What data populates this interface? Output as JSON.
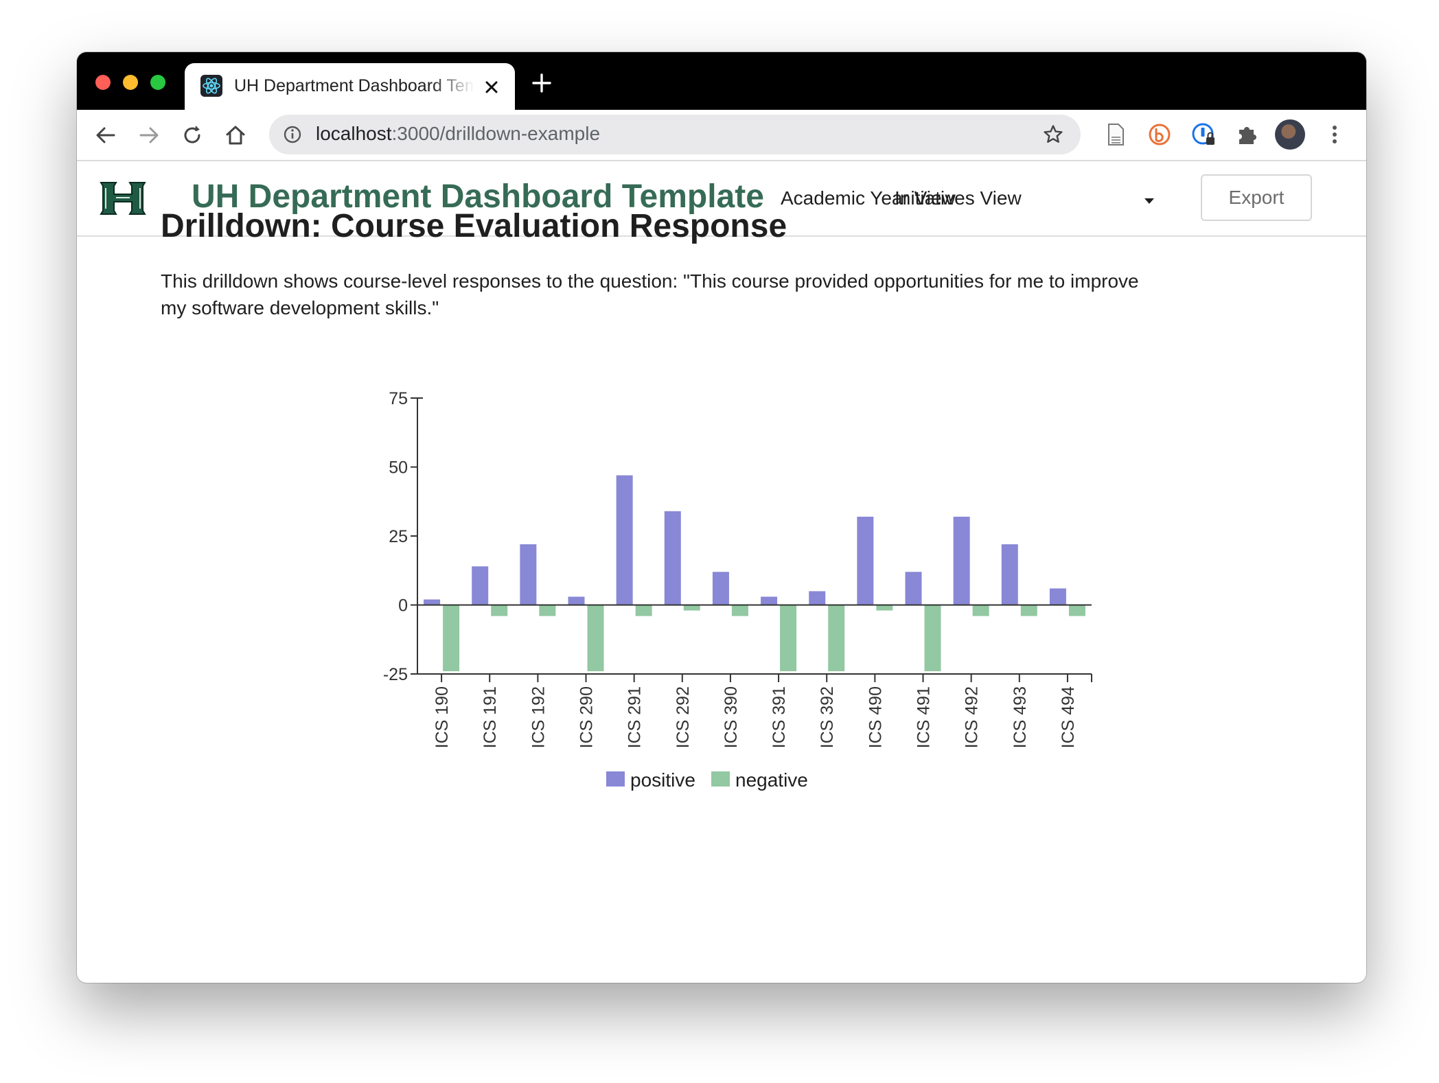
{
  "browser": {
    "tab_title": "UH Department Dashboard Template",
    "url_host": "localhost",
    "url_path": ":3000/drilldown-example"
  },
  "navbar": {
    "brand": "UH Department Dashboard Template",
    "links": [
      "Academic Year View",
      "Initiatives View"
    ],
    "export_label": "Export"
  },
  "page": {
    "heading": "Drilldown: Course Evaluation Response",
    "description": "This drilldown shows course-level responses to the question: \"This course provided opportunities for me to improve my software development skills.\""
  },
  "colors": {
    "positive": "#8888d6",
    "negative": "#92c8a2",
    "brand": "#366b56"
  },
  "chart_data": {
    "type": "bar",
    "categories": [
      "ICS 190",
      "ICS 191",
      "ICS 192",
      "ICS 290",
      "ICS 291",
      "ICS 292",
      "ICS 390",
      "ICS 391",
      "ICS 392",
      "ICS 490",
      "ICS 491",
      "ICS 492",
      "ICS 493",
      "ICS 494"
    ],
    "series": [
      {
        "name": "positive",
        "values": [
          2,
          14,
          22,
          3,
          47,
          34,
          12,
          3,
          5,
          32,
          12,
          32,
          22,
          6
        ]
      },
      {
        "name": "negative",
        "values": [
          -24,
          -4,
          -4,
          -24,
          -4,
          -2,
          -4,
          -24,
          -24,
          -2,
          -24,
          -4,
          -4,
          -4
        ]
      }
    ],
    "yticks": [
      75,
      50,
      25,
      0,
      -25
    ],
    "ylim": [
      -25,
      75
    ],
    "legend": "bottom-center"
  }
}
